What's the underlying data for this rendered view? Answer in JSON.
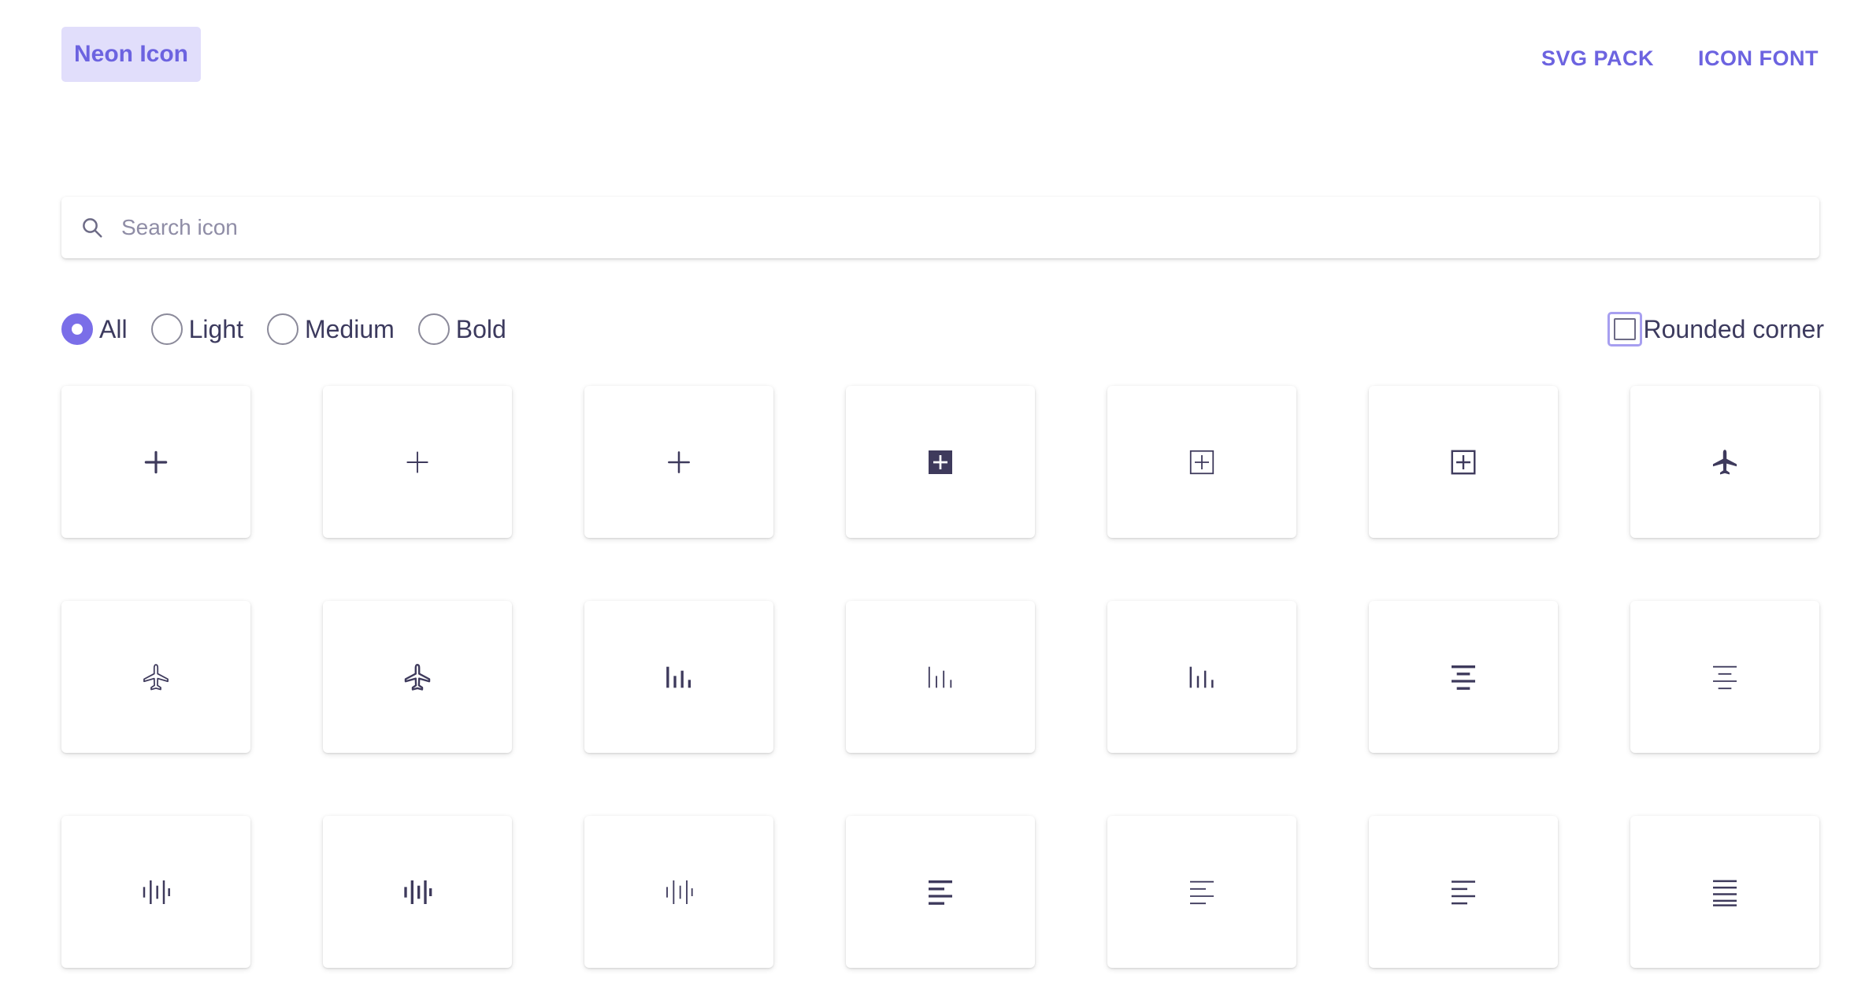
{
  "header": {
    "logo_label": "Neon Icon",
    "nav": [
      {
        "label": "SVG PACK"
      },
      {
        "label": "ICON FONT"
      }
    ]
  },
  "search": {
    "placeholder": "Search icon",
    "value": ""
  },
  "filters": {
    "weights": [
      {
        "label": "All",
        "checked": true
      },
      {
        "label": "Light",
        "checked": false
      },
      {
        "label": "Medium",
        "checked": false
      },
      {
        "label": "Bold",
        "checked": false
      }
    ],
    "rounded_corner": {
      "label": "Rounded corner",
      "checked": false
    }
  },
  "colors": {
    "accent": "#6c63e0",
    "logo_bg": "#e1defb",
    "icon": "#3e3a5c"
  },
  "icons": [
    {
      "name": "add-icon",
      "weight": "bold"
    },
    {
      "name": "add-icon",
      "weight": "light"
    },
    {
      "name": "add-icon",
      "weight": "medium"
    },
    {
      "name": "add-square-filled-icon",
      "weight": "bold"
    },
    {
      "name": "add-square-icon",
      "weight": "light"
    },
    {
      "name": "add-square-icon",
      "weight": "medium"
    },
    {
      "name": "airplane-filled-icon",
      "weight": "bold"
    },
    {
      "name": "airplane-icon",
      "weight": "light"
    },
    {
      "name": "airplane-icon",
      "weight": "medium"
    },
    {
      "name": "bar-chart-icon",
      "weight": "bold"
    },
    {
      "name": "bar-chart-icon",
      "weight": "light"
    },
    {
      "name": "bar-chart-icon",
      "weight": "medium"
    },
    {
      "name": "align-center-icon",
      "weight": "bold"
    },
    {
      "name": "align-center-icon",
      "weight": "light"
    },
    {
      "name": "audio-wave-icon",
      "weight": "medium"
    },
    {
      "name": "audio-wave-icon",
      "weight": "bold"
    },
    {
      "name": "audio-wave-icon",
      "weight": "light"
    },
    {
      "name": "align-left-icon",
      "weight": "bold"
    },
    {
      "name": "align-left-icon",
      "weight": "light"
    },
    {
      "name": "align-left-icon",
      "weight": "medium"
    },
    {
      "name": "align-justify-icon",
      "weight": "medium"
    }
  ]
}
